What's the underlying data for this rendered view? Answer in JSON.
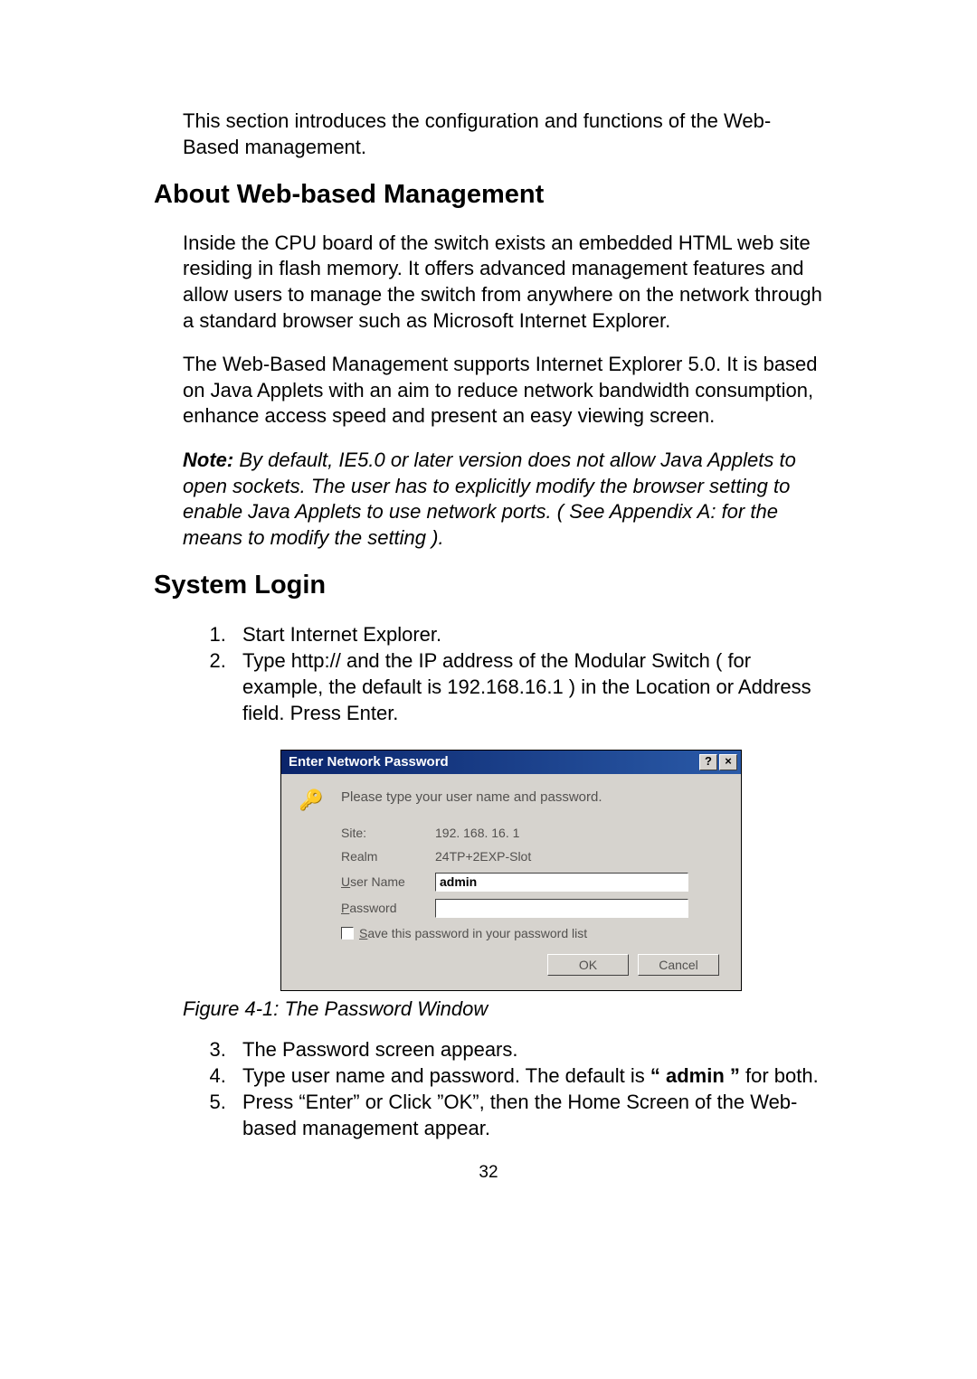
{
  "intro": "This section introduces the configuration and functions of the Web-Based management.",
  "section1": {
    "heading": "About Web-based Management",
    "p1": "Inside the CPU board of the switch exists an embedded HTML web site residing in flash memory. It offers advanced management features and allow users to manage the switch from anywhere on the network through a standard browser such as Microsoft Internet Explorer.",
    "p2": "The Web-Based Management supports Internet Explorer 5.0. It is based on Java Applets with an aim to reduce network bandwidth consumption, enhance access speed and present an easy viewing screen.",
    "note_label": "Note:",
    "note_body": " By default, IE5.0 or later version does not allow Java Applets to open sockets. The user has to explicitly modify the browser setting to enable Java Applets to use network ports. ( See Appendix A: for the means to modify the setting )."
  },
  "section2": {
    "heading": "System Login",
    "li1": "Start Internet Explorer.",
    "li2": "Type http:// and the IP address of the Modular Switch ( for example, the default is 192.168.16.1 ) in the Location or Address field. Press Enter.",
    "li3": "The Password screen appears.",
    "li4_pre": "Type user name and password. The default is ",
    "li4_bold": "“ admin ”",
    "li4_post": " for both.",
    "li5": "Press “Enter” or Click ”OK”, then the Home Screen of the Web-based management appear."
  },
  "dialog": {
    "title": "Enter Network Password",
    "help": "?",
    "close": "×",
    "instruction": "Please type your user name and password.",
    "site_label": "Site:",
    "site_value": "192. 168. 16. 1",
    "realm_label": "Realm",
    "realm_value": "24TP+2EXP-Slot",
    "username_label_pre": "U",
    "username_label_post": "ser Name",
    "username_value": "admin",
    "password_label_pre": "P",
    "password_label_post": "assword",
    "password_value": "",
    "checkbox_label_pre": "S",
    "checkbox_label_post": "ave this password in your password list",
    "ok": "OK",
    "cancel": "Cancel"
  },
  "figure_caption": "Figure 4-1: The Password Window",
  "page_number": "32"
}
